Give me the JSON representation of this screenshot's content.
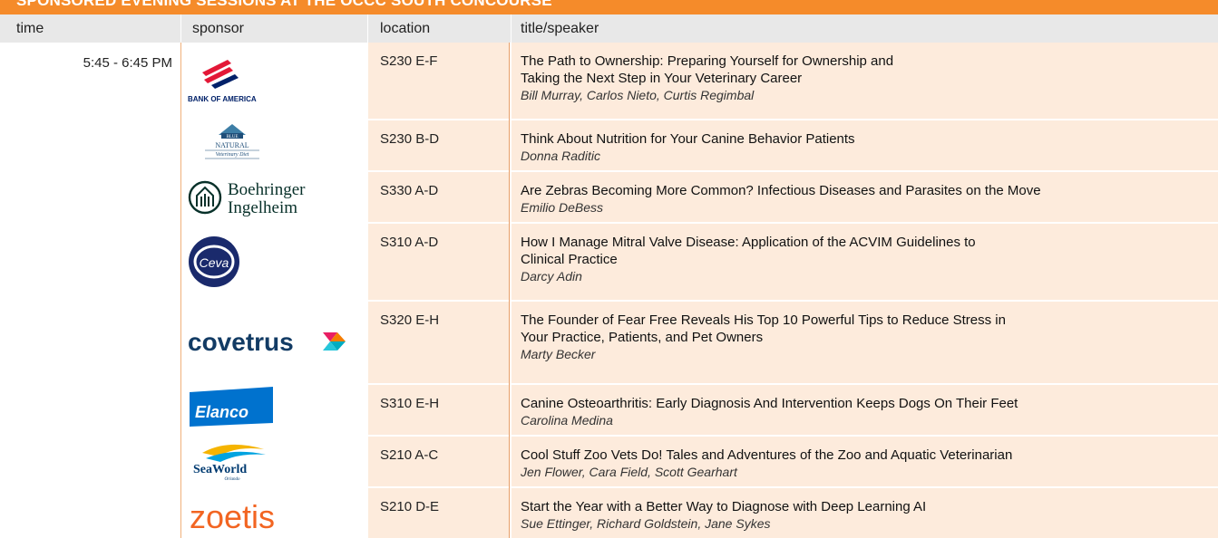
{
  "banner": {
    "text": "SPONSORED EVENING SESSIONS AT THE OCCC SOUTH CONCOURSE"
  },
  "columns": {
    "time": "time",
    "sponsor": "sponsor",
    "location": "location",
    "title": "title/speaker"
  },
  "time_slot": "5:45 - 6:45 PM",
  "rows": [
    {
      "sponsor": "BANK OF AMERICA",
      "location": "S230 E-F",
      "title1": "The Path to Ownership: Preparing Yourself for Ownership and",
      "title2": "Taking the Next Step in Your Veterinary Career",
      "speakers": "Bill Murray, Carlos Nieto, Curtis Regimbal"
    },
    {
      "sponsor": "BLUE NATURAL Veterinary Diet",
      "location": "S230 B-D",
      "title1": "Think About Nutrition for Your Canine Behavior Patients",
      "title2": "",
      "speakers": "Donna Raditic"
    },
    {
      "sponsor": "Boehringer Ingelheim",
      "location": "S330 A-D",
      "title1": "Are Zebras Becoming More Common? Infectious Diseases and Parasites on the Move",
      "title2": "",
      "speakers": "Emilio DeBess"
    },
    {
      "sponsor": "Ceva",
      "location": "S310 A-D",
      "title1": "How I Manage Mitral Valve Disease: Application of the ACVIM Guidelines to",
      "title2": "Clinical Practice",
      "speakers": "Darcy Adin"
    },
    {
      "sponsor": "covetrus",
      "location": "S320 E-H",
      "title1": "The Founder of Fear Free Reveals His Top 10 Powerful Tips to Reduce Stress in",
      "title2": "Your Practice, Patients, and Pet Owners",
      "speakers": "Marty Becker"
    },
    {
      "sponsor": "Elanco",
      "location": "S310 E-H",
      "title1": "Canine Osteoarthritis: Early Diagnosis And Intervention Keeps Dogs On Their Feet",
      "title2": "",
      "speakers": "Carolina Medina"
    },
    {
      "sponsor": "SeaWorld",
      "location": "S210 A-C",
      "title1": "Cool Stuff Zoo Vets Do! Tales and Adventures of the Zoo and Aquatic Veterinarian",
      "title2": "",
      "speakers": "Jen Flower, Cara Field, Scott Gearhart"
    },
    {
      "sponsor": "zoetis",
      "location": "S210 D-E",
      "title1": "Start the Year with a Better Way to Diagnose with Deep Learning AI",
      "title2": "",
      "speakers": "Sue Ettinger, Richard Goldstein, Jane Sykes"
    }
  ],
  "colors": {
    "banner": "#f58b2a",
    "cell_bg": "#fdebdc",
    "header_bg": "#e8e8e8"
  },
  "logos": {
    "boa_sub": "BANK OF AMERICA",
    "blue_top": "BLUE",
    "blue_mid": "NATURAL",
    "blue_sub": "Veterinary Diet",
    "bi_1": "Boehringer",
    "bi_2": "Ingelheim",
    "ceva": "Ceva",
    "covetrus": "covetrus",
    "elanco": "Elanco",
    "seaworld": "SeaWorld",
    "seaworld_sub": "Orlando",
    "zoetis": "zoetis"
  }
}
